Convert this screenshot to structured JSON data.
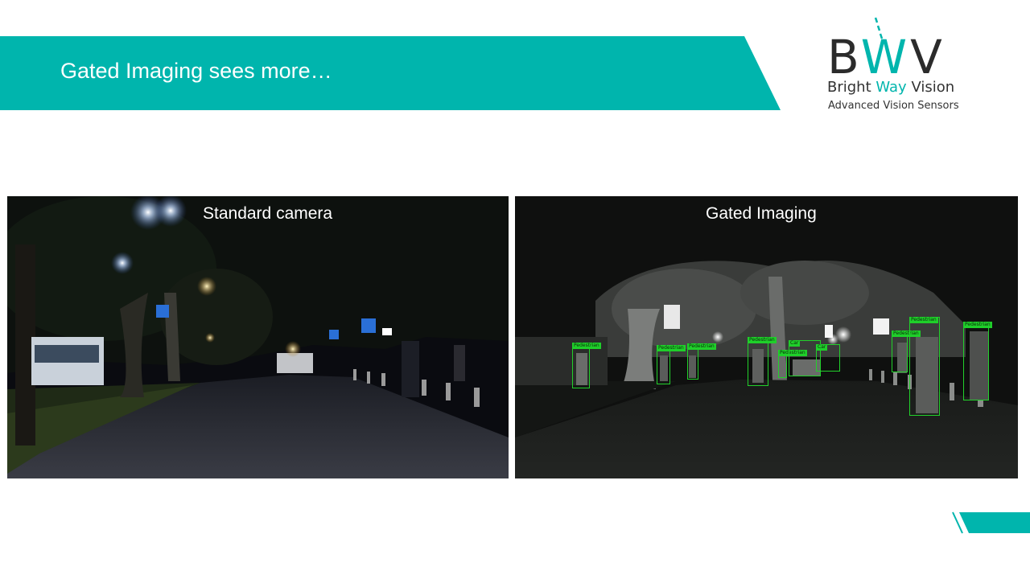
{
  "slide": {
    "title": "Gated Imaging sees more…",
    "accent_color": "#00b5ad"
  },
  "logo": {
    "word_b": "B",
    "word_w": "W",
    "word_v": "V",
    "line1_a": "Bright ",
    "line1_b": "Way",
    "line1_c": " Vision",
    "line2": "Advanced Vision Sensors"
  },
  "panels": {
    "left": {
      "caption": "Standard camera"
    },
    "right": {
      "caption": "Gated Imaging"
    }
  },
  "detections": [
    {
      "label": "Pedestrian"
    },
    {
      "label": "Pedestrian"
    },
    {
      "label": "Pedestrian"
    },
    {
      "label": "Pedestrian"
    },
    {
      "label": "Pedestrian"
    },
    {
      "label": "Car"
    },
    {
      "label": "Car"
    },
    {
      "label": "Pedestrian"
    },
    {
      "label": "Pedestrian"
    },
    {
      "label": "Pedestrian"
    }
  ]
}
